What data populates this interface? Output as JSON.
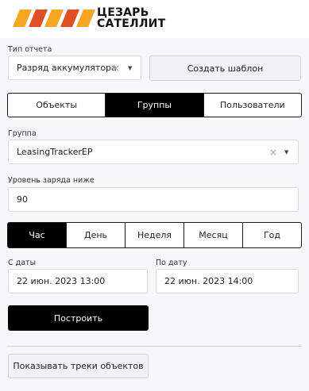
{
  "brand": {
    "line1": "ЦЕЗАРЬ",
    "line2": "САТЕЛЛИТ",
    "stripe_color": "#f5a623",
    "stripe_color_dark": "#e04e24"
  },
  "report_type": {
    "label": "Тип отчета",
    "value": "Разряд аккумулятора",
    "clear_icon": "×",
    "caret_icon": "▼"
  },
  "create_template_label": "Создать шаблон",
  "target_tabs": [
    {
      "label": "Объекты",
      "active": false
    },
    {
      "label": "Группы",
      "active": true
    },
    {
      "label": "Пользователи",
      "active": false
    }
  ],
  "group": {
    "label": "Группа",
    "value": "LeasingTrackerEP",
    "clear_icon": "×",
    "caret_icon": "▼"
  },
  "charge_level": {
    "label": "Уровень заряда ниже",
    "value": "90"
  },
  "period_tabs": [
    {
      "label": "Час",
      "active": true
    },
    {
      "label": "День",
      "active": false
    },
    {
      "label": "Неделя",
      "active": false
    },
    {
      "label": "Месяц",
      "active": false
    },
    {
      "label": "Год",
      "active": false
    }
  ],
  "date_from": {
    "label": "С даты",
    "value": "22 июн. 2023 13:00"
  },
  "date_to": {
    "label": "По дату",
    "value": "22 июн. 2023 14:00"
  },
  "build_label": "Построить",
  "show_tracks_label": "Показывать треки объектов"
}
